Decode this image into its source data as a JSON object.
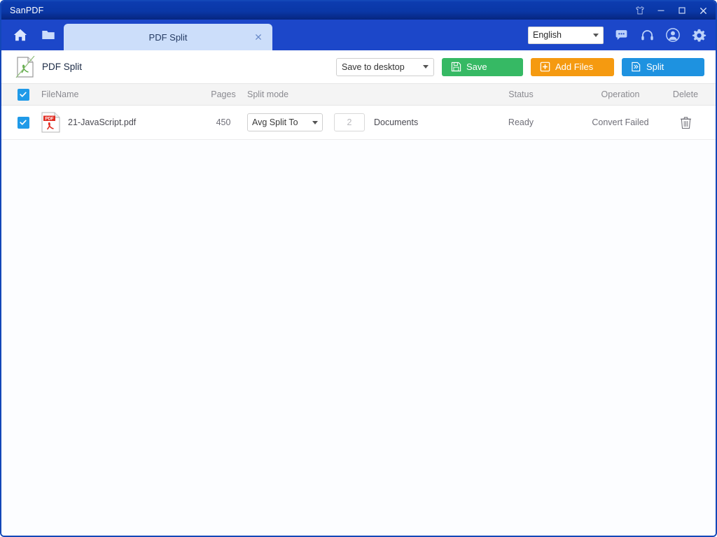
{
  "window": {
    "title": "SanPDF",
    "controls": [
      {
        "name": "theme",
        "icon": "tshirt-icon"
      },
      {
        "name": "minimize",
        "icon": "minimize-icon"
      },
      {
        "name": "maximize",
        "icon": "maximize-icon"
      },
      {
        "name": "close",
        "icon": "close-icon"
      }
    ]
  },
  "nav": {
    "home_icon": "home-icon",
    "folder_icon": "folder-icon",
    "tab": {
      "label": "PDF Split",
      "close_label": "×"
    },
    "language": {
      "value": "English",
      "icon": "chevron-down-icon"
    },
    "icons": [
      {
        "name": "chat-icon",
        "label": "Feedback"
      },
      {
        "name": "headphones-icon",
        "label": "Support"
      },
      {
        "name": "user-avatar-icon",
        "label": "Account"
      },
      {
        "name": "gear-icon",
        "label": "Settings"
      }
    ]
  },
  "toolbar": {
    "module_icon": "pdf-split-icon",
    "module_title": "PDF Split",
    "save_path": {
      "value": "Save to desktop",
      "icon": "chevron-down-icon"
    },
    "save_button": {
      "label": "Save",
      "icon": "floppy-disk-icon",
      "color": "#36b964"
    },
    "add_files_button": {
      "label": "Add Files",
      "icon": "plus-square-icon",
      "color": "#f59a10"
    },
    "split_button": {
      "label": "Split",
      "icon": "split-doc-icon",
      "color": "#1e92e0"
    }
  },
  "table": {
    "select_all_checked": true,
    "headers": {
      "filename": "FileName",
      "pages": "Pages",
      "split_mode": "Split mode",
      "status": "Status",
      "operation": "Operation",
      "delete": "Delete"
    },
    "rows": [
      {
        "checked": true,
        "file_icon": "pdf-file-icon",
        "filename": "21-JavaScript.pdf",
        "pages": "450",
        "split_mode": "Avg Split To",
        "split_count": "2",
        "split_unit": "Documents",
        "status": "Ready",
        "operation": "Convert Failed",
        "delete_icon": "trash-icon"
      }
    ]
  },
  "colors": {
    "title_bar": "#0a37a6",
    "nav_bar": "#1c47c9",
    "tab_active": "#ccdefa",
    "accent_blue": "#1f9ae8",
    "save_green": "#36b964",
    "add_orange": "#f59a10",
    "split_blue": "#1e92e0",
    "header_band": "#f4f4f4"
  }
}
